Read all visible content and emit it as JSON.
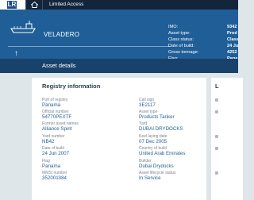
{
  "topbar": {
    "logo_letter": "LR",
    "title": "Limited Access"
  },
  "hero": {
    "vessel_name": "VELADERO",
    "info": [
      {
        "key": "IMO:",
        "value": "9342"
      },
      {
        "key": "Asset type:",
        "value": "Prod"
      },
      {
        "key": "Class status:",
        "value": "Class"
      },
      {
        "key": "Date of build:",
        "value": "24 Ju"
      },
      {
        "key": "Gross tonnage:",
        "value": "4252"
      },
      {
        "key": "Flag:",
        "value": "Pana"
      }
    ]
  },
  "section": {
    "title": "Asset details"
  },
  "registry": {
    "heading": "Registry information",
    "left": [
      {
        "label": "Port of registry",
        "value": "Panama"
      },
      {
        "label": "Official number",
        "value": "54770PEXTF"
      },
      {
        "label": "Former asset names",
        "value": "Alliance Spirit"
      },
      {
        "label": "Yard number",
        "value": "NB42"
      },
      {
        "label": "Date of build",
        "value": "24 Jun 2007"
      },
      {
        "label": "Flag",
        "value": "Panama"
      },
      {
        "label": "MMSI number",
        "value": "352001384"
      }
    ],
    "right": [
      {
        "label": "Call sign",
        "value": "3E2117"
      },
      {
        "label": "Asset type",
        "value": "Products Tanker"
      },
      {
        "label": "Yard",
        "value": "DUBAI DRYDOCKS"
      },
      {
        "label": "Keel laying date",
        "value": "07 Dec 2005"
      },
      {
        "label": "Country of build",
        "value": "United Arab Emirates"
      },
      {
        "label": "Builder",
        "value": "Dubai Drydocks"
      },
      {
        "label": "Asset lifecycle status",
        "value": "In Service"
      }
    ]
  },
  "right_card": {
    "heading": "L"
  }
}
